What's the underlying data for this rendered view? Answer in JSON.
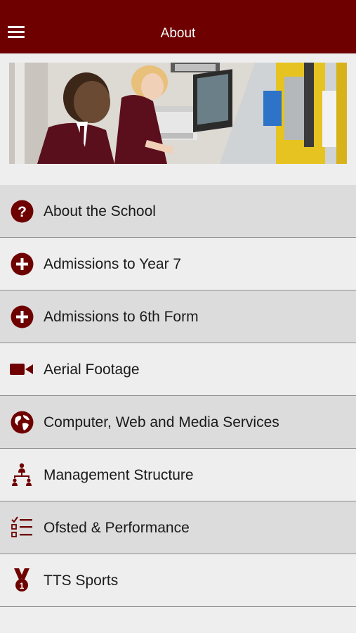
{
  "header": {
    "title": "About"
  },
  "colors": {
    "brand": "#6e0000",
    "row_dark": "#dcdcdc",
    "row_light": "#eeeeee"
  },
  "menu": {
    "items": [
      {
        "label": "About the School",
        "icon": "question-circle-icon"
      },
      {
        "label": "Admissions to Year 7",
        "icon": "plus-circle-icon"
      },
      {
        "label": "Admissions to 6th Form",
        "icon": "plus-circle-icon"
      },
      {
        "label": "Aerial Footage",
        "icon": "video-camera-icon"
      },
      {
        "label": "Computer, Web and Media Services",
        "icon": "globe-icon"
      },
      {
        "label": "Management Structure",
        "icon": "org-chart-icon"
      },
      {
        "label": "Ofsted & Performance",
        "icon": "checklist-icon"
      },
      {
        "label": "TTS Sports",
        "icon": "medal-icon"
      }
    ]
  }
}
